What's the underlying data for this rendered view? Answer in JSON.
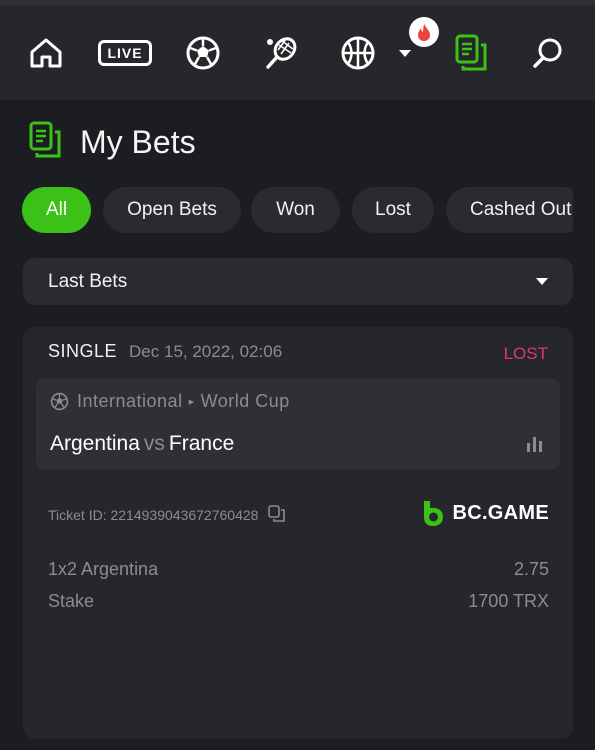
{
  "nav": {
    "live_label": "LIVE"
  },
  "page": {
    "title": "My Bets"
  },
  "filters": [
    {
      "label": "All",
      "active": true
    },
    {
      "label": "Open Bets",
      "active": false
    },
    {
      "label": "Won",
      "active": false
    },
    {
      "label": "Lost",
      "active": false
    },
    {
      "label": "Cashed Out",
      "active": false
    }
  ],
  "dropdown": {
    "selected": "Last Bets"
  },
  "bet": {
    "type": "SINGLE",
    "date": "Dec 15, 2022, 02:06",
    "status": "LOST",
    "status_color": "#e0357a",
    "league_country": "International",
    "league_name": "World Cup",
    "home": "Argentina",
    "vs": "vs",
    "away": "France",
    "ticket_id": "Ticket ID: 2214939043672760428",
    "brand": "BC.GAME",
    "selection_label": "1x2 Argentina",
    "odds": "2.75",
    "stake_label": "Stake",
    "stake_value": "1700 TRX"
  },
  "colors": {
    "accent": "#3bc117",
    "background": "#1c1d20",
    "surface": "#26272b"
  }
}
